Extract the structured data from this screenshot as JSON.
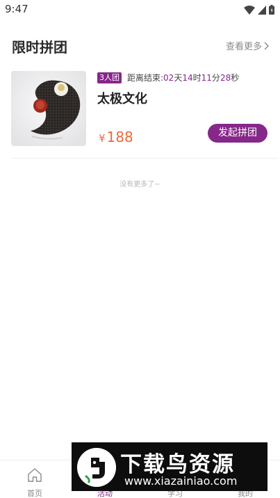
{
  "status_bar": {
    "time": "9:47"
  },
  "header": {
    "title": "限时拼团",
    "view_more": "查看更多"
  },
  "group_card": {
    "badge": "3人团",
    "countdown_label": "距离结束:",
    "countdown": {
      "days": "02",
      "days_unit": "天",
      "hours": "14",
      "hours_unit": "时",
      "minutes": "11",
      "minutes_unit": "分",
      "seconds": "28",
      "seconds_unit": "秒"
    },
    "title": "太极文化",
    "currency": "¥",
    "price": "188",
    "button_label": "发起拼团"
  },
  "list_end_text": "没有更多了~",
  "bottom_nav": [
    {
      "label": "首页",
      "icon": "home-icon",
      "active": false
    },
    {
      "label": "活动",
      "icon": "activity-icon",
      "active": true
    },
    {
      "label": "学习",
      "icon": "study-icon",
      "active": false
    },
    {
      "label": "我的",
      "icon": "profile-icon",
      "active": false
    }
  ],
  "watermark": {
    "title": "下载鸟资源",
    "url": "www.xiazainiao.com"
  },
  "colors": {
    "accent": "#86278a",
    "price": "#ee6a3c",
    "muted": "#8a8a8a"
  }
}
